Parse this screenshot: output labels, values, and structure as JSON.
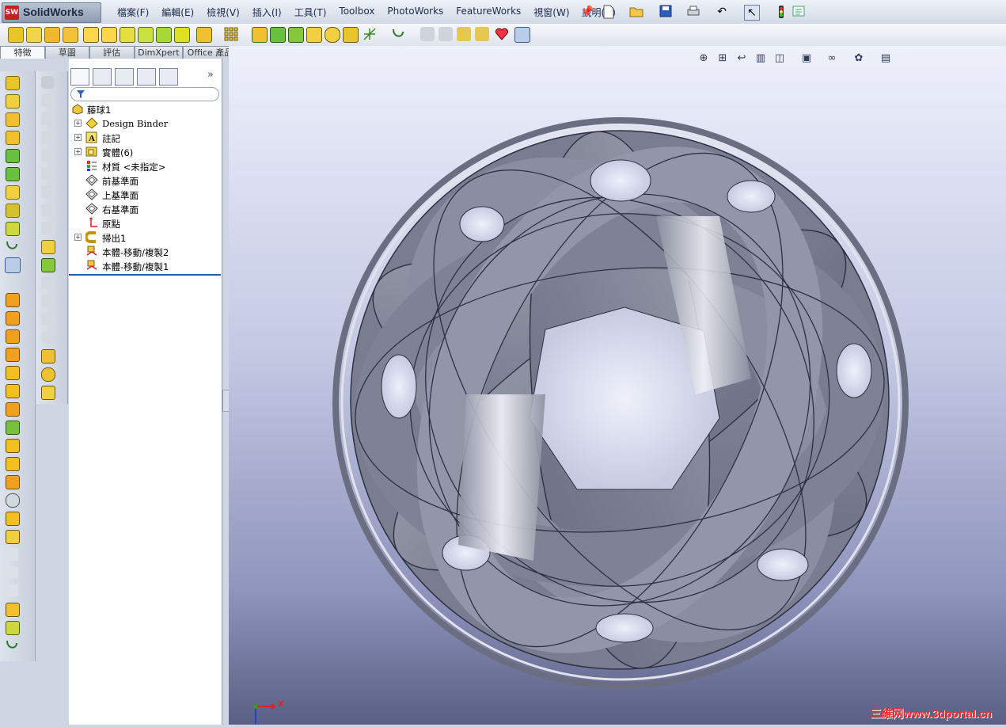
{
  "app": {
    "logo_badge": "SW",
    "name": "SolidWorks"
  },
  "menu": {
    "items": [
      "檔案(F)",
      "編輯(E)",
      "檢視(V)",
      "插入(I)",
      "工具(T)",
      "Toolbox",
      "PhotoWorks",
      "FeatureWorks",
      "視窗(W)",
      "說明(H)"
    ]
  },
  "command_tabs": [
    {
      "label": "特徵",
      "active": true
    },
    {
      "label": "草圖",
      "active": false
    },
    {
      "label": "評估",
      "active": false
    },
    {
      "label": "DimXpert",
      "active": false
    },
    {
      "label": "Office 產品",
      "active": false
    }
  ],
  "feature_tree": {
    "root": "藤球1",
    "items": [
      {
        "label": "Design Binder",
        "icon": "binder-icon",
        "expandable": true
      },
      {
        "label": "註記",
        "icon": "annotation-icon",
        "expandable": true
      },
      {
        "label": "實體(6)",
        "icon": "solid-bodies-icon",
        "expandable": true
      },
      {
        "label": "材質 <未指定>",
        "icon": "material-icon",
        "expandable": false
      },
      {
        "label": "前基準面",
        "icon": "plane-icon",
        "expandable": false
      },
      {
        "label": "上基準面",
        "icon": "plane-icon",
        "expandable": false
      },
      {
        "label": "右基準面",
        "icon": "plane-icon",
        "expandable": false
      },
      {
        "label": "原點",
        "icon": "origin-icon",
        "expandable": false
      },
      {
        "label": "掃出1",
        "icon": "sweep-icon",
        "expandable": true
      },
      {
        "label": "本體-移動/複製2",
        "icon": "move-copy-body-icon",
        "expandable": false
      },
      {
        "label": "本體-移動/複製1",
        "icon": "move-copy-body-icon",
        "expandable": false
      }
    ]
  },
  "viewport": {
    "triad_x_label": "X",
    "watermark": "三維网www.3dportal.cn"
  },
  "colors": {
    "accent": "#2b5aa8",
    "ribbon_dark": "#7f8294",
    "ribbon_light": "#d9dbe3",
    "logo_red": "#c62020"
  }
}
